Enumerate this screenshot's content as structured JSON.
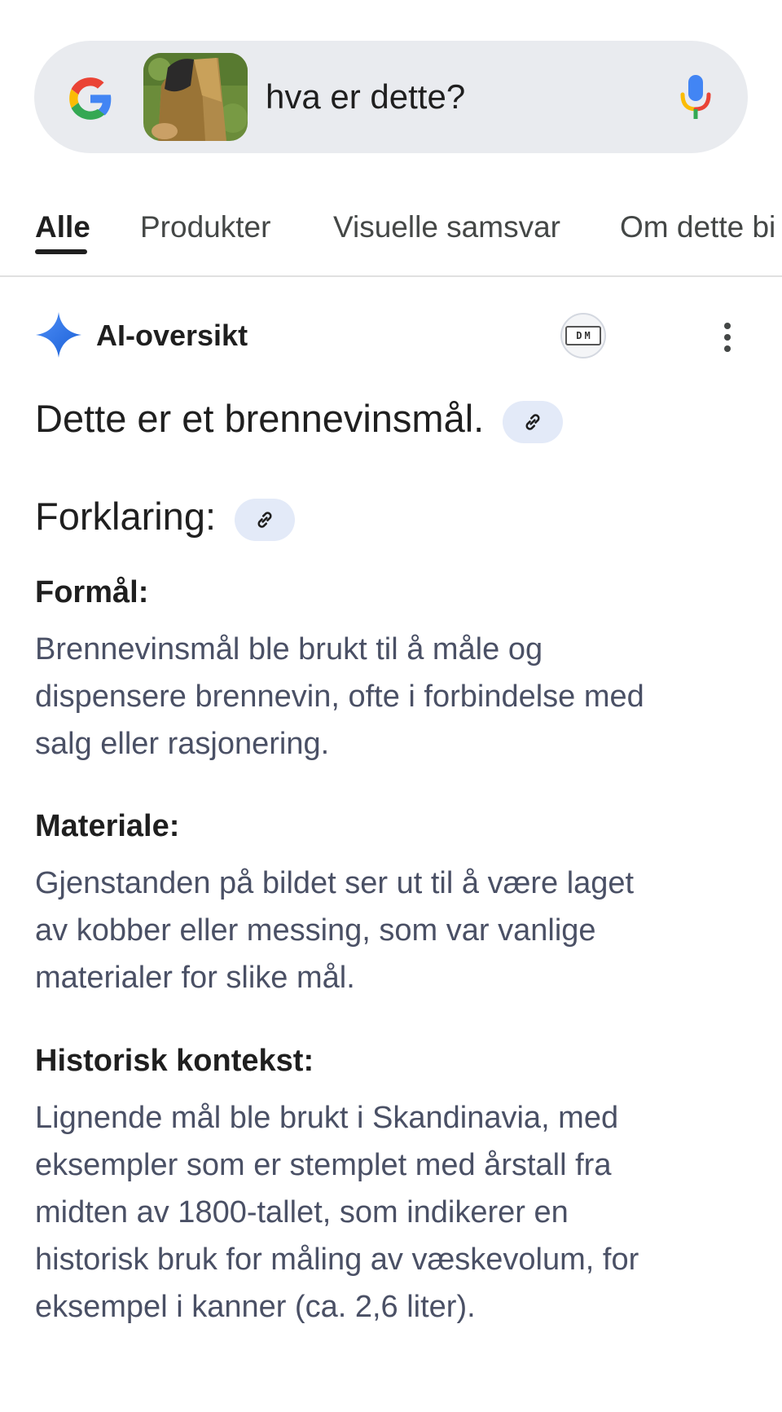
{
  "search": {
    "query": "hva er dette?"
  },
  "tabs": [
    {
      "label": "Alle"
    },
    {
      "label": "Produkter"
    },
    {
      "label": "Visuelle samsvar"
    },
    {
      "label": "Om dette bi"
    }
  ],
  "ai_overview": {
    "title": "AI-oversikt",
    "source_logo_letters": [
      "D",
      "M"
    ],
    "headline": "Dette er et brennevinsmål.",
    "explanation_heading": "Forklaring:",
    "sections": [
      {
        "heading": "Formål:",
        "lines": [
          "Brennevinsmål ble brukt til å måle og",
          "dispensere brennevin, ofte i forbindelse med",
          "salg eller rasjonering."
        ]
      },
      {
        "heading": "Materiale:",
        "lines": [
          "Gjenstanden på bildet ser ut til å være laget",
          "av kobber eller messing, som var vanlige",
          "materialer for slike mål."
        ]
      },
      {
        "heading": "Historisk kontekst:",
        "lines": [
          "Lignende mål ble brukt i Skandinavia, med",
          "eksempler som er stemplet med årstall fra",
          "midten av 1800-tallet, som indikerer en",
          "historisk bruk for måling av væskevolum, for",
          "eksempel i kanner (ca. 2,6 liter)."
        ]
      }
    ]
  },
  "icons": {
    "google_logo": "google-g-icon",
    "mic": "microphone-icon",
    "ai": "sparkle-icon",
    "link": "link-icon",
    "more": "more-vert-icon"
  },
  "colors": {
    "search_bg": "#e9ebef",
    "link_chip_bg": "#e3eaf8",
    "body_text": "#4a5065",
    "sparkle": "#1a73e8"
  }
}
